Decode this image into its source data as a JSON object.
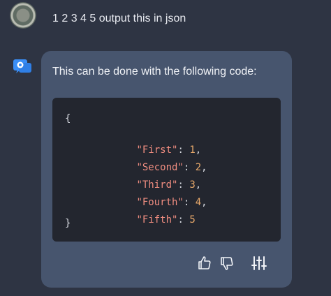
{
  "user": {
    "message": "1 2 3 4 5 output this in json"
  },
  "assistant": {
    "intro": "This can be done with the following code:",
    "code": {
      "open": "{",
      "entries": [
        {
          "key": "\"First\"",
          "value": "1",
          "comma": ","
        },
        {
          "key": "\"Second\"",
          "value": "2",
          "comma": ","
        },
        {
          "key": "\"Third\"",
          "value": "3",
          "comma": ","
        },
        {
          "key": "\"Fourth\"",
          "value": "4",
          "comma": ","
        },
        {
          "key": "\"Fifth\"",
          "value": "5",
          "comma": ""
        }
      ],
      "colon": ": ",
      "close": "}"
    },
    "actions": [
      "thumbs-up-icon",
      "thumbs-down-icon",
      "sliders-icon"
    ]
  },
  "colors": {
    "background": "#2e3443",
    "bubble": "#47556e",
    "code_background": "#23262f",
    "key": "#f08d80",
    "number": "#e7a86a",
    "bot_icon": "#3a8ef6"
  }
}
